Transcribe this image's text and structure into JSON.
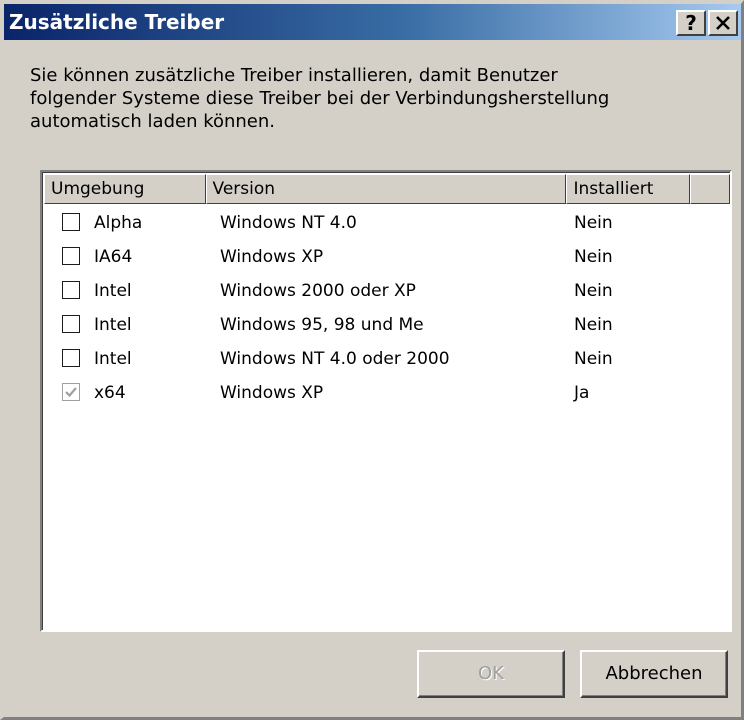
{
  "window": {
    "title": "Zusätzliche Treiber",
    "help_label": "?",
    "close_label": "✕"
  },
  "description": "Sie können zusätzliche Treiber installieren, damit Benutzer\nfolgender Systeme diese Treiber bei der Verbindungsherstellung\nautomatisch laden können.",
  "table": {
    "columns": [
      "Umgebung",
      "Version",
      "Installiert"
    ],
    "rows": [
      {
        "checked": false,
        "disabled": false,
        "environment": "Alpha",
        "version": "Windows NT 4.0",
        "installed": "Nein"
      },
      {
        "checked": false,
        "disabled": false,
        "environment": "IA64",
        "version": "Windows XP",
        "installed": "Nein"
      },
      {
        "checked": false,
        "disabled": false,
        "environment": "Intel",
        "version": "Windows 2000 oder XP",
        "installed": "Nein"
      },
      {
        "checked": false,
        "disabled": false,
        "environment": "Intel",
        "version": "Windows 95, 98 und Me",
        "installed": "Nein"
      },
      {
        "checked": false,
        "disabled": false,
        "environment": "Intel",
        "version": "Windows NT 4.0 oder 2000",
        "installed": "Nein"
      },
      {
        "checked": true,
        "disabled": true,
        "environment": "x64",
        "version": "Windows XP",
        "installed": "Ja"
      }
    ]
  },
  "buttons": {
    "ok_label": "OK",
    "cancel_label": "Abbrechen"
  },
  "colors": {
    "titlebar_start": "#0a246a",
    "titlebar_end": "#a6caf0",
    "face": "#d4d0c8",
    "disabled_text": "#a0a0a0"
  }
}
